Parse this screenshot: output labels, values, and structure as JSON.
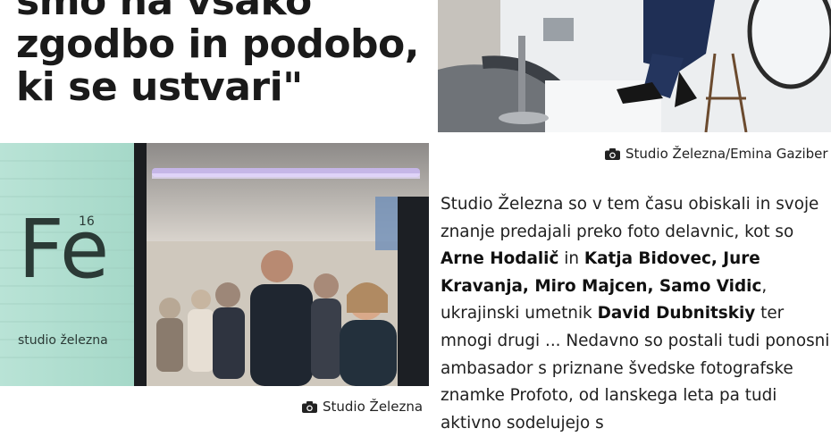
{
  "headline": {
    "line1": "smo na vsako",
    "line2": "zgodbo in podobo,",
    "line3": "ki se ustvari\""
  },
  "event_photo": {
    "sign_symbol": "Fe",
    "sign_number": "16",
    "sign_text": "studio železna",
    "caption": "Studio Železna"
  },
  "studio_photo": {
    "caption": "Studio Železna/Emina Gaziber"
  },
  "article": {
    "p1": "Studio Železna so v tem času obiskali in svoje znanje predajali preko foto delavnic, kot so ",
    "name1": "Arne Hodalič",
    "p2": " in ",
    "name2": "Katja Bidovec, Jure Kravanja, Miro Majcen, Samo Vidic",
    "p3": ", ukrajinski umetnik ",
    "name3": "David Dubnitskiy",
    "p4": " ter mnogi drugi ... Nedavno so postali tudi ponosni ambasador s priznane švedske fotografske znamke Profoto, od lanskega leta pa tudi aktivno sodelujejo s"
  },
  "icons": {
    "camera": "camera-icon"
  },
  "colors": {
    "text": "#111111",
    "accent_lilac": "#c9b8f0"
  }
}
